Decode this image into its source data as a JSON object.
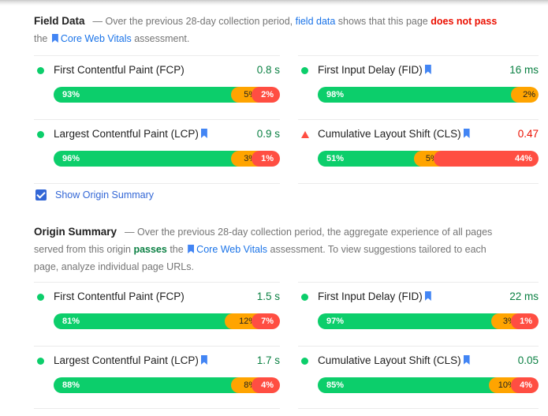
{
  "field_data": {
    "title": "Field Data",
    "desc_prefix": "— Over the previous 28-day collection period, ",
    "desc_link": "field data",
    "desc_mid": " shows that this page ",
    "verdict": "does not pass",
    "desc_line2_prefix": "the ",
    "cwv_link": "Core Web Vitals",
    "desc_suffix": " assessment.",
    "metrics": [
      {
        "name": "First Contentful Paint (FCP)",
        "bookmark": false,
        "value": "0.8 s",
        "status": "good",
        "fast": "93%",
        "average": "5%",
        "slow": "2%"
      },
      {
        "name": "First Input Delay (FID)",
        "bookmark": true,
        "value": "16 ms",
        "status": "good",
        "fast": "98%",
        "average": "2%",
        "slow": ""
      },
      {
        "name": "Largest Contentful Paint (LCP)",
        "bookmark": true,
        "value": "0.9 s",
        "status": "good",
        "fast": "96%",
        "average": "3%",
        "slow": "1%"
      },
      {
        "name": "Cumulative Layout Shift (CLS)",
        "bookmark": true,
        "value": "0.47",
        "status": "poor",
        "fast": "51%",
        "average": "5%",
        "slow": "44%"
      }
    ]
  },
  "show_origin_summary": {
    "label": "Show Origin Summary",
    "checked": true
  },
  "origin_summary": {
    "title": "Origin Summary",
    "desc_prefix": "— Over the previous 28-day collection period, the aggregate experience of all pages",
    "desc_line2_prefix": "served from this origin ",
    "verdict": "passes",
    "desc_mid": " the ",
    "cwv_link": "Core Web Vitals",
    "desc_suffix": " assessment. To view suggestions tailored to each",
    "desc_line3": "page, analyze individual page URLs.",
    "metrics": [
      {
        "name": "First Contentful Paint (FCP)",
        "bookmark": false,
        "value": "1.5 s",
        "status": "good",
        "fast": "81%",
        "average": "12%",
        "slow": "7%"
      },
      {
        "name": "First Input Delay (FID)",
        "bookmark": true,
        "value": "22 ms",
        "status": "good",
        "fast": "97%",
        "average": "3%",
        "slow": "1%"
      },
      {
        "name": "Largest Contentful Paint (LCP)",
        "bookmark": true,
        "value": "1.7 s",
        "status": "good",
        "fast": "88%",
        "average": "8%",
        "slow": "4%"
      },
      {
        "name": "Cumulative Layout Shift (CLS)",
        "bookmark": true,
        "value": "0.05",
        "status": "good",
        "fast": "85%",
        "average": "10%",
        "slow": "4%"
      }
    ]
  },
  "colors": {
    "fast": "#0cce6b",
    "average": "#ffa400",
    "slow": "#ff4e42",
    "link": "#1a73e8",
    "pass": "#0b8043",
    "fail": "#eb0f00"
  }
}
